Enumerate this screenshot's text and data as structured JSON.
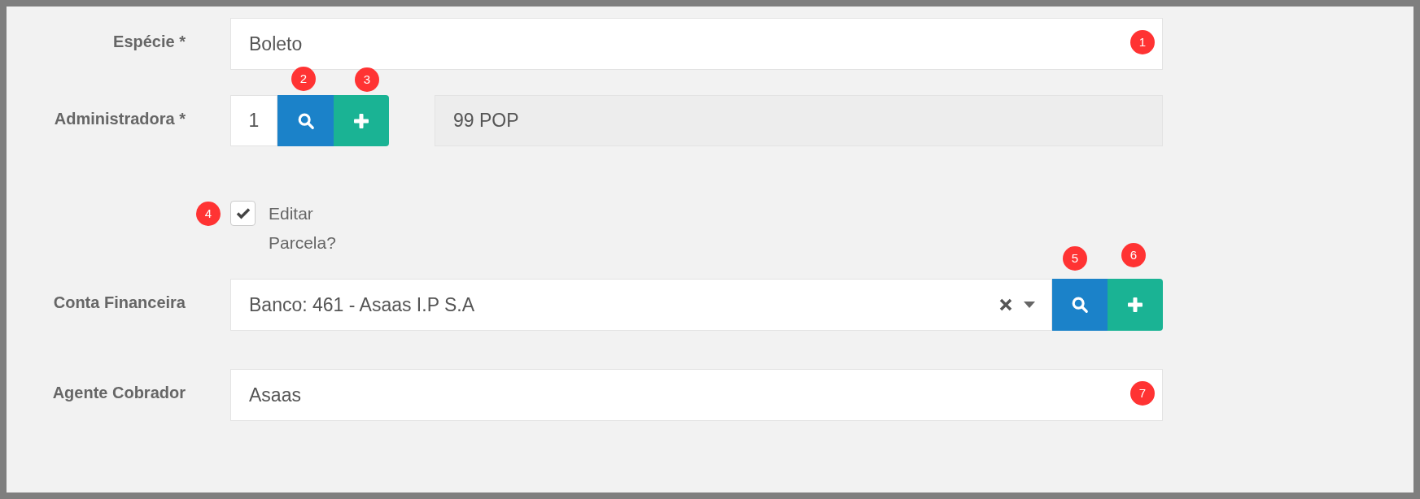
{
  "fields": [
    {
      "kind": "text",
      "label": "Espécie *",
      "value": "Boleto",
      "marker": "1"
    },
    {
      "kind": "lookup",
      "label": "Administradora *",
      "code": "1",
      "value": "99 POP",
      "markers": [
        "2",
        "3"
      ]
    },
    {
      "kind": "checkbox",
      "label": "Editar Parcela?",
      "checked": true,
      "marker": "4"
    },
    {
      "kind": "select",
      "label": "Conta Financeira",
      "value": "Banco: 461 - Asaas I.P S.A",
      "markers": [
        "5",
        "6"
      ]
    },
    {
      "kind": "text",
      "label": "Agente Cobrador",
      "value": "Asaas",
      "marker": "7"
    }
  ]
}
